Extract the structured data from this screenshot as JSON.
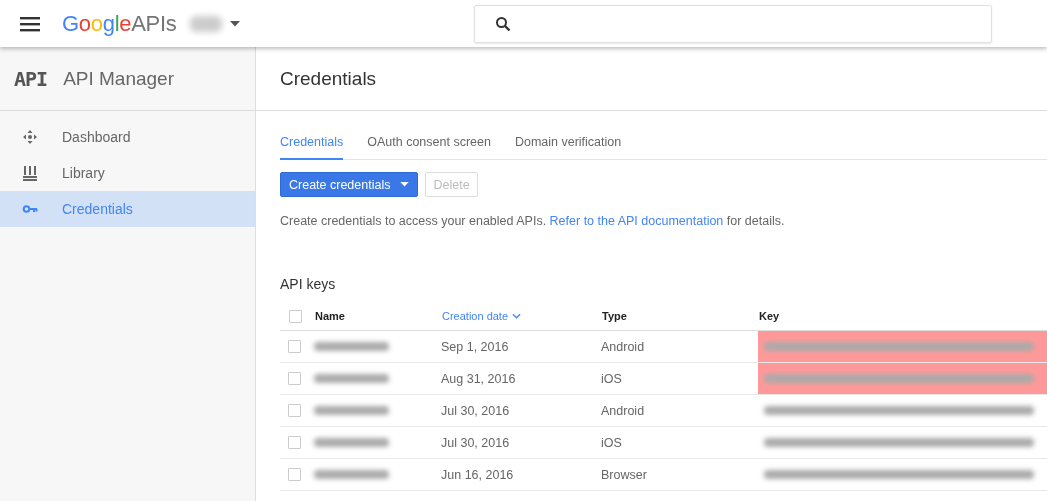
{
  "header": {
    "logo_brand": "Google",
    "logo_suffix": "APIs"
  },
  "sidebar": {
    "logo": "API",
    "title": "API Manager",
    "items": [
      {
        "label": "Dashboard",
        "selected": false
      },
      {
        "label": "Library",
        "selected": false
      },
      {
        "label": "Credentials",
        "selected": true
      }
    ]
  },
  "page": {
    "title": "Credentials",
    "tabs": [
      {
        "label": "Credentials",
        "selected": true
      },
      {
        "label": "OAuth consent screen",
        "selected": false
      },
      {
        "label": "Domain verification",
        "selected": false
      }
    ],
    "buttons": [
      {
        "label": "Create credentials",
        "kind": "primary",
        "disabled": false
      },
      {
        "label": "Delete",
        "kind": "plain",
        "disabled": true
      }
    ],
    "description": {
      "before": "Create credentials to access your enabled APIs. ",
      "link": "Refer to the API documentation",
      "after": " for details."
    },
    "section_title": "API keys",
    "table": {
      "select_all": {
        "checked": false
      },
      "columns": [
        {
          "label": "Name",
          "sorted": false
        },
        {
          "label": "Creation date",
          "sorted": true
        },
        {
          "label": "Type",
          "sorted": false
        },
        {
          "label": "Key",
          "sorted": false
        }
      ],
      "rows": [
        {
          "checked": false,
          "date": "Sep 1, 2016",
          "type": "Android",
          "highlighted": true
        },
        {
          "checked": false,
          "date": "Aug 31, 2016",
          "type": "iOS",
          "highlighted": true
        },
        {
          "checked": false,
          "date": "Jul 30, 2016",
          "type": "Android",
          "highlighted": false
        },
        {
          "checked": false,
          "date": "Jul 30, 2016",
          "type": "iOS",
          "highlighted": false
        },
        {
          "checked": false,
          "date": "Jun 16, 2016",
          "type": "Browser",
          "highlighted": false
        }
      ]
    }
  }
}
